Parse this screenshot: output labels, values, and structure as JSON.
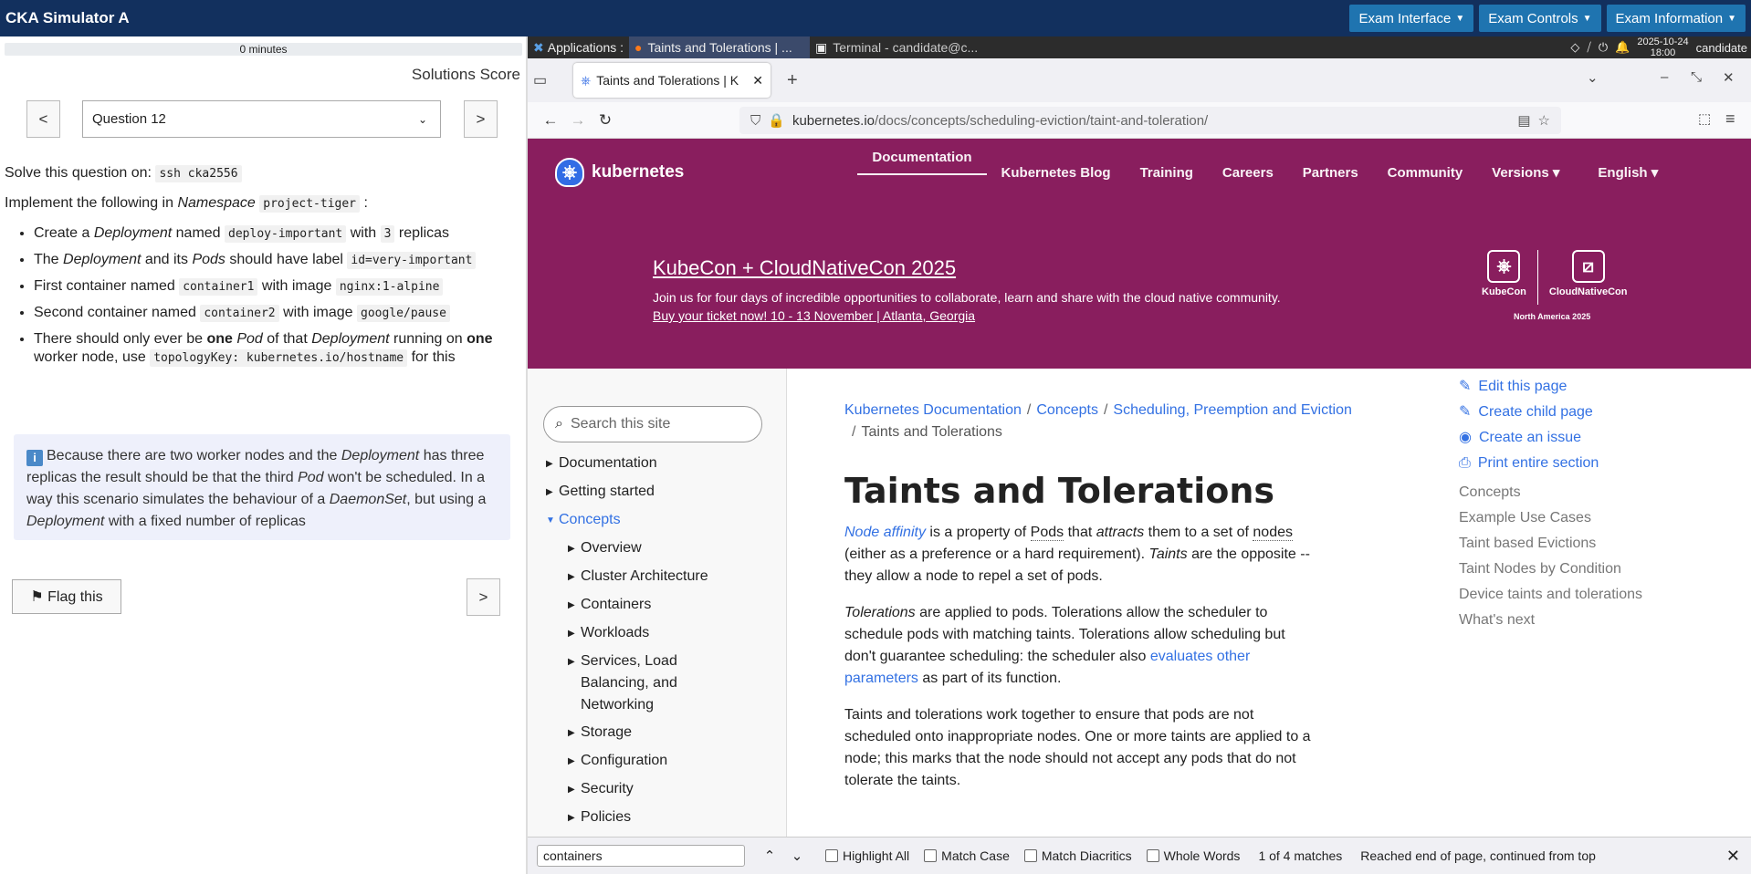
{
  "app_title": "CKA Simulator A",
  "topbar": {
    "exam_interface": "Exam Interface",
    "exam_controls": "Exam Controls",
    "exam_information": "Exam Information"
  },
  "left": {
    "timer": "0 minutes",
    "solutions_score": "Solutions Score",
    "prev": "<",
    "next": ">",
    "question_select": "Question 12",
    "solve_prefix": "Solve this question on:",
    "ssh_cmd": "ssh cka2556",
    "impl_prefix": "Implement the following in",
    "namespace_word": "Namespace",
    "namespace": "project-tiger",
    "flag": "⚑ Flag this",
    "next_bottom": ">"
  },
  "tasks": {
    "t1a": "Create a",
    "t1b": "Deployment",
    "t1c": "named",
    "t1d": "deploy-important",
    "t1e": "with",
    "t1f": "3",
    "t1g": "replicas",
    "t2a": "The",
    "t2b": "Deployment",
    "t2c": "and its",
    "t2d": "Pods",
    "t2e": "should have label",
    "t2f": "id=very-important",
    "t3a": "First container named",
    "t3b": "container1",
    "t3c": "with image",
    "t3d": "nginx:1-alpine",
    "t4a": "Second container named",
    "t4b": "container2",
    "t4c": "with image",
    "t4d": "google/pause",
    "t5a": "There should only ever be",
    "t5b": "one",
    "t5c": "Pod",
    "t5d": "of that",
    "t5e": "Deployment",
    "t5f": "running on",
    "t5g": "one",
    "t5h": "worker node, use",
    "t5i": "topologyKey: kubernetes.io/hostname",
    "t5j": "for this"
  },
  "info": {
    "i1": "Because there are two worker nodes and the",
    "i2": "Deployment",
    "i3": "has three replicas the result should be that the third",
    "i4": "Pod",
    "i5": "won't be scheduled. In a way this scenario simulates the behaviour of a",
    "i6": "DaemonSet",
    "i7": ", but using a",
    "i8": "Deployment",
    "i9": "with a fixed number of replicas"
  },
  "desktop": {
    "applications": "Applications :",
    "task_browser": "Taints and Tolerations | ...",
    "task_terminal": "Terminal - candidate@c...",
    "date": "2025-10-24",
    "time": "18:00",
    "user": "candidate"
  },
  "firefox": {
    "tab_title": "Taints and Tolerations | K",
    "url_host": "kubernetes.io",
    "url_path": "/docs/concepts/scheduling-eviction/taint-and-toleration/"
  },
  "k8s": {
    "brand": "kubernetes",
    "menu": [
      "Documentation",
      "Kubernetes Blog",
      "Training",
      "Careers",
      "Partners",
      "Community",
      "Versions ▾",
      "English ▾"
    ],
    "banner_title": "KubeCon + CloudNativeCon 2025",
    "banner_text": "Join us for four days of incredible opportunities to collaborate, learn and share with the cloud native community.",
    "banner_link": "Buy your ticket now! 10 - 13 November | Atlanta, Georgia",
    "kc_left": "KubeCon",
    "kc_right": "CloudNativeCon",
    "kc_sub": "North America 2025"
  },
  "sidebar": {
    "search_placeholder": "Search this site",
    "items": [
      "Documentation",
      "Getting started",
      "Concepts",
      "Overview",
      "Cluster Architecture",
      "Containers",
      "Workloads",
      "Services, Load Balancing, and Networking",
      "Storage",
      "Configuration",
      "Security",
      "Policies"
    ]
  },
  "breadcrumb": {
    "c1": "Kubernetes Documentation",
    "c2": "Concepts",
    "c3": "Scheduling, Preemption and Eviction",
    "c4": "Taints and Tolerations"
  },
  "doc": {
    "title": "Taints and Tolerations",
    "p1a": "Node affinity",
    "p1b": "is a property of",
    "p1c": "Pods",
    "p1d": "that",
    "p1e": "attracts",
    "p1f": "them to a set of",
    "p1g": "nodes",
    "p1h": "(either as a preference or a hard requirement).",
    "p1i": "Taints",
    "p1j": "are the opposite -- they allow a node to repel a set of pods.",
    "p2a": "Tolerations",
    "p2b": "are applied to pods. Tolerations allow the scheduler to schedule pods with matching taints. Tolerations allow scheduling but don't guarantee scheduling: the scheduler also",
    "p2c": "evaluates other parameters",
    "p2d": "as part of its function.",
    "p3": "Taints and tolerations work together to ensure that pods are not scheduled onto inappropriate nodes. One or more taints are applied to a node; this marks that the node should not accept any pods that do not tolerate the taints."
  },
  "toc": {
    "actions": [
      "Edit this page",
      "Create child page",
      "Create an issue",
      "Print entire section"
    ],
    "items": [
      "Concepts",
      "Example Use Cases",
      "Taint based Evictions",
      "Taint Nodes by Condition",
      "Device taints and tolerations",
      "What's next"
    ]
  },
  "findbar": {
    "query": "containers",
    "highlight_all": "Highlight All",
    "match_case": "Match Case",
    "match_diacritics": "Match Diacritics",
    "whole_words": "Whole Words",
    "count": "1 of 4 matches",
    "status": "Reached end of page, continued from top"
  },
  "colors": {
    "topbar": "#12305e",
    "topbar_button": "#1f74b0",
    "k8s_magenta": "#891e5e",
    "link_blue": "#3371e3"
  }
}
